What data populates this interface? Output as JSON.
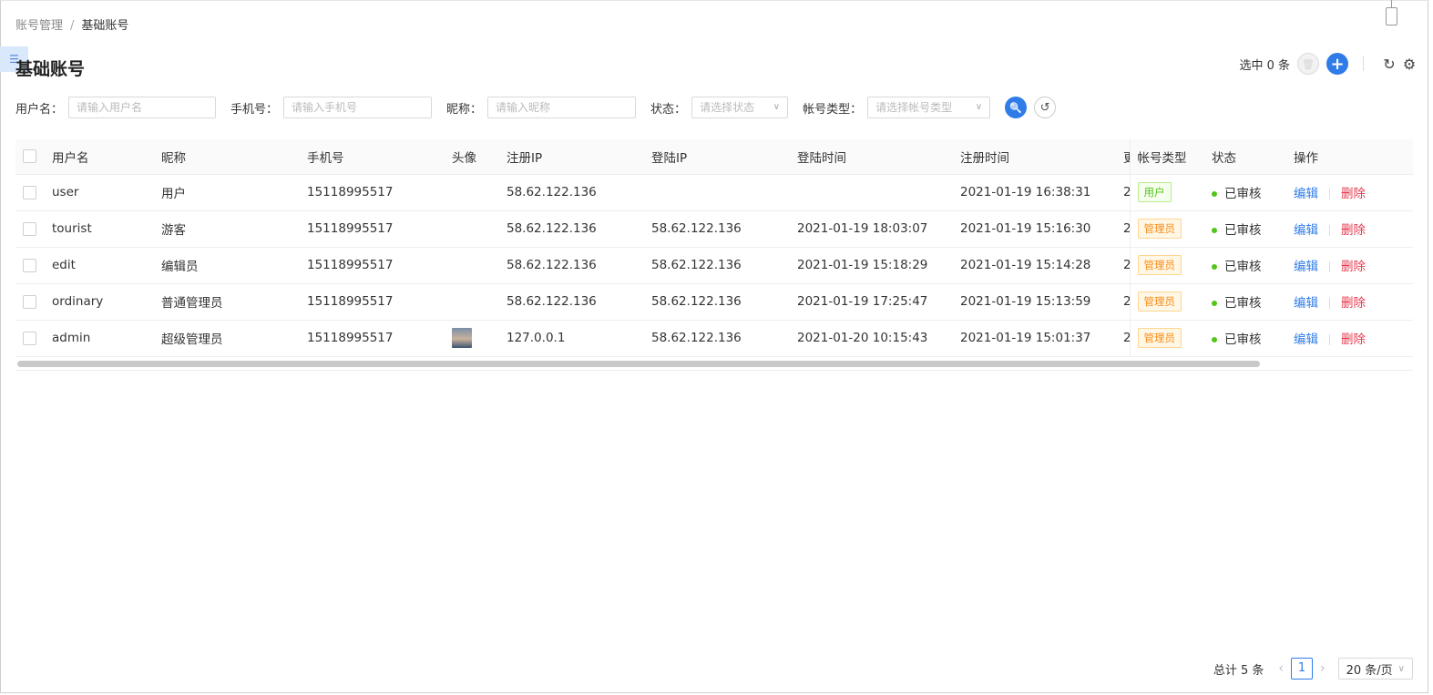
{
  "breadcrumb": {
    "parent": "账号管理",
    "separator": "/",
    "current": "基础账号"
  },
  "side_toggle": "☰",
  "page_title": "基础账号",
  "toolbar": {
    "selected_text": "选中 0 条",
    "trash_icon": "🗑",
    "add_icon": "+",
    "refresh_icon": "↻",
    "settings_icon": "⚙"
  },
  "filters": {
    "username": {
      "label": "用户名：",
      "placeholder": "请输入用户名"
    },
    "phone": {
      "label": "手机号：",
      "placeholder": "请输入手机号"
    },
    "nickname": {
      "label": "昵称：",
      "placeholder": "请输入昵称"
    },
    "status": {
      "label": "状态：",
      "placeholder": "请选择状态"
    },
    "account_type": {
      "label": "帐号类型：",
      "placeholder": "请选择帐号类型"
    },
    "search_icon": "🔍",
    "reset_icon": "↺"
  },
  "table": {
    "headers": [
      "用户名",
      "昵称",
      "手机号",
      "头像",
      "注册IP",
      "登陆IP",
      "登陆时间",
      "注册时间",
      "更",
      "帐号类型",
      "状态",
      "操作"
    ],
    "rows": [
      {
        "username": "user",
        "nickname": "用户",
        "phone": "15118995517",
        "avatar": false,
        "reg_ip": "58.62.122.136",
        "login_ip": "",
        "login_time": "",
        "reg_time": "2021-01-19 16:38:31",
        "update": "2",
        "type": "用户",
        "type_style": "user",
        "status": "已审核",
        "edit": "编辑",
        "delete": "删除"
      },
      {
        "username": "tourist",
        "nickname": "游客",
        "phone": "15118995517",
        "avatar": false,
        "reg_ip": "58.62.122.136",
        "login_ip": "58.62.122.136",
        "login_time": "2021-01-19 18:03:07",
        "reg_time": "2021-01-19 15:16:30",
        "update": "2",
        "type": "管理员",
        "type_style": "admin",
        "status": "已审核",
        "edit": "编辑",
        "delete": "删除"
      },
      {
        "username": "edit",
        "nickname": "编辑员",
        "phone": "15118995517",
        "avatar": false,
        "reg_ip": "58.62.122.136",
        "login_ip": "58.62.122.136",
        "login_time": "2021-01-19 15:18:29",
        "reg_time": "2021-01-19 15:14:28",
        "update": "2",
        "type": "管理员",
        "type_style": "admin",
        "status": "已审核",
        "edit": "编辑",
        "delete": "删除"
      },
      {
        "username": "ordinary",
        "nickname": "普通管理员",
        "phone": "15118995517",
        "avatar": false,
        "reg_ip": "58.62.122.136",
        "login_ip": "58.62.122.136",
        "login_time": "2021-01-19 17:25:47",
        "reg_time": "2021-01-19 15:13:59",
        "update": "2",
        "type": "管理员",
        "type_style": "admin",
        "status": "已审核",
        "edit": "编辑",
        "delete": "删除"
      },
      {
        "username": "admin",
        "nickname": "超级管理员",
        "phone": "15118995517",
        "avatar": true,
        "reg_ip": "127.0.0.1",
        "login_ip": "58.62.122.136",
        "login_time": "2021-01-20 10:15:43",
        "reg_time": "2021-01-19 15:01:37",
        "update": "2",
        "type": "管理员",
        "type_style": "admin",
        "status": "已审核",
        "edit": "编辑",
        "delete": "删除"
      }
    ]
  },
  "pagination": {
    "total": "总计 5 条",
    "prev": "‹",
    "current": "1",
    "next": "›",
    "page_size": "20 条/页",
    "chevron": "∨"
  },
  "colors": {
    "primary": "#2f7ce8",
    "danger": "#e8384d",
    "success": "#52c41a",
    "warning": "#fa8c16"
  }
}
